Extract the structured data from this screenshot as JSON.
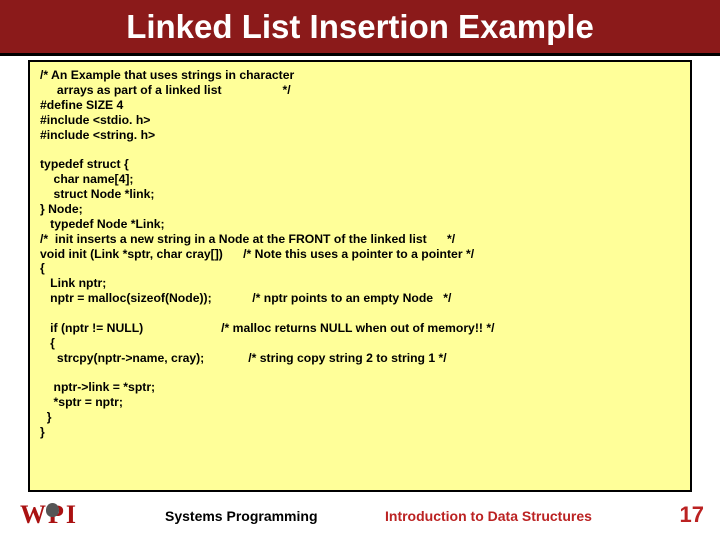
{
  "title": "Linked List Insertion Example",
  "code_lines": [
    "/* An Example that uses strings in character",
    "     arrays as part of a linked list                  */",
    "#define SIZE 4",
    "#include <stdio. h>",
    "#include <string. h>",
    "",
    "typedef struct {",
    "    char name[4];",
    "    struct Node *link;",
    "} Node;",
    "   typedef Node *Link;",
    "/*  init inserts a new string in a Node at the FRONT of the linked list      */",
    "void init (Link *sptr, char cray[])      /* Note this uses a pointer to a pointer */",
    "{",
    "   Link nptr;",
    "   nptr = malloc(sizeof(Node));            /* nptr points to an empty Node   */",
    "",
    "   if (nptr != NULL)                       /* malloc returns NULL when out of memory!! */",
    "   {",
    "     strcpy(nptr->name, cray);             /* string copy string 2 to string 1 */",
    "",
    "    nptr->link = *sptr;",
    "    *sptr = nptr;",
    "  }",
    "}"
  ],
  "footer": {
    "center": "Systems Programming",
    "right": "Introduction to Data Structures",
    "pagenum": "17",
    "logo": "WPI"
  }
}
